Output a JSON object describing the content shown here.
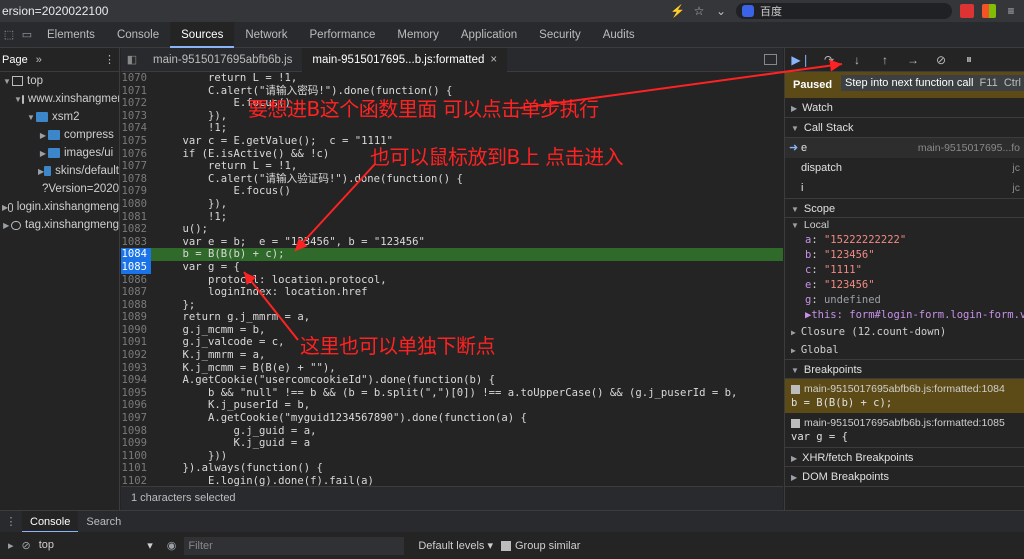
{
  "urlbar": {
    "url": "ersion=2020022100",
    "search": "百度"
  },
  "devtools_tabs": [
    "Elements",
    "Console",
    "Sources",
    "Network",
    "Performance",
    "Memory",
    "Application",
    "Security",
    "Audits"
  ],
  "navigator": {
    "head": "Page",
    "tree": [
      {
        "label": "top",
        "indent": 0,
        "icon": "frame",
        "open": true
      },
      {
        "label": "www.xinshangmeng",
        "indent": 1,
        "icon": "cloud",
        "open": true
      },
      {
        "label": "xsm2",
        "indent": 2,
        "icon": "folder",
        "open": true
      },
      {
        "label": "compress",
        "indent": 3,
        "icon": "folder",
        "open": false
      },
      {
        "label": "images/ui",
        "indent": 3,
        "icon": "folder",
        "open": false
      },
      {
        "label": "skins/default",
        "indent": 3,
        "icon": "folder",
        "open": false
      },
      {
        "label": "?Version=2020",
        "indent": 3,
        "icon": "file",
        "open": null
      },
      {
        "label": "login.xinshangmeng",
        "indent": 0,
        "icon": "cloud",
        "open": false
      },
      {
        "label": "tag.xinshangmeng",
        "indent": 0,
        "icon": "cloud",
        "open": false
      }
    ]
  },
  "editor": {
    "tabs": [
      {
        "label": "main-9515017695abfb6b.js",
        "active": false
      },
      {
        "label": "main-9515017695...b.js:formatted",
        "active": true
      }
    ],
    "status": "1 characters selected",
    "lines": [
      {
        "n": "1070",
        "t": "        return L = !1,"
      },
      {
        "n": "1071",
        "t": "        C.alert(\"请输入密码!\").done(function() {"
      },
      {
        "n": "1072",
        "t": "            E.focus()"
      },
      {
        "n": "1073",
        "t": "        }),"
      },
      {
        "n": "1074",
        "t": "        !1;"
      },
      {
        "n": "1075",
        "t": "    var c = E.getValue();  c = \"1111\""
      },
      {
        "n": "1076",
        "t": "    if (E.isActive() && !c)"
      },
      {
        "n": "1077",
        "t": "        return L = !1,"
      },
      {
        "n": "1078",
        "t": "        C.alert(\"请输入验证码!\").done(function() {"
      },
      {
        "n": "1079",
        "t": "            E.focus()"
      },
      {
        "n": "1080",
        "t": "        }),"
      },
      {
        "n": "1081",
        "t": "        !1;"
      },
      {
        "n": "1082",
        "t": "    u();"
      },
      {
        "n": "1083",
        "t": "    var e = b;  e = \"123456\", b = \"123456\""
      },
      {
        "n": "1084",
        "t": "    b = B(B(b) + c);"
      },
      {
        "n": "1085",
        "t": "    var g = {"
      },
      {
        "n": "1086",
        "t": "        protocol: location.protocol,"
      },
      {
        "n": "1087",
        "t": "        loginIndex: location.href"
      },
      {
        "n": "1088",
        "t": "    };"
      },
      {
        "n": "1089",
        "t": "    return g.j_mmrm = a,"
      },
      {
        "n": "1090",
        "t": "    g.j_mcmm = b,"
      },
      {
        "n": "1091",
        "t": "    g.j_valcode = c,"
      },
      {
        "n": "1092",
        "t": "    K.j_mmrm = a,"
      },
      {
        "n": "1093",
        "t": "    K.j_mcmm = B(B(e) + \"\"),"
      },
      {
        "n": "1094",
        "t": "    A.getCookie(\"usercomcookieId\").done(function(b) {"
      },
      {
        "n": "1095",
        "t": "        b && \"null\" !== b && (b = b.split(\",\")[0]) !== a.toUpperCase() && (g.j_puserId = b,"
      },
      {
        "n": "1096",
        "t": "        K.j_puserId = b,"
      },
      {
        "n": "1097",
        "t": "        A.getCookie(\"myguid1234567890\").done(function(a) {"
      },
      {
        "n": "1098",
        "t": "            g.j_guid = a,"
      },
      {
        "n": "1099",
        "t": "            K.j_guid = a"
      },
      {
        "n": "1100",
        "t": "        }))"
      },
      {
        "n": "1101",
        "t": "    }).always(function() {"
      },
      {
        "n": "1102",
        "t": "        E.login(g).done(f).fail(a)"
      }
    ]
  },
  "debugger": {
    "paused": "Paused",
    "tooltip": "Step into next function call",
    "tooltip_key": "F11",
    "tooltip_extra": "Ctrl",
    "sections": {
      "watch": "Watch",
      "call_stack": "Call Stack",
      "scope": "Scope",
      "local": "Local",
      "closure": "Closure (12.count-down)",
      "global": "Global",
      "breakpoints": "Breakpoints",
      "xhr": "XHR/fetch Breakpoints",
      "dom": "DOM Breakpoints"
    },
    "frames": [
      {
        "name": "e",
        "src": "main-9515017695...fo"
      },
      {
        "name": "dispatch",
        "src": "jc"
      },
      {
        "name": "i",
        "src": "jc"
      }
    ],
    "locals": [
      {
        "k": "a",
        "v": "\"15222222222\""
      },
      {
        "k": "b",
        "v": "\"123456\""
      },
      {
        "k": "c",
        "v": "\"1111\""
      },
      {
        "k": "e",
        "v": "\"123456\""
      },
      {
        "k": "g",
        "v": "undefined"
      }
    ],
    "this_row": "▶this: form#login-form.login-form.val",
    "breakpoints": [
      {
        "file": "main-9515017695abfb6b.js:formatted:1084",
        "code": "b = B(B(b) + c);"
      },
      {
        "file": "main-9515017695abfb6b.js:formatted:1085",
        "code": "var g = {"
      }
    ]
  },
  "drawer": {
    "tabs": [
      "Console",
      "Search"
    ],
    "context": "top",
    "filter_placeholder": "Filter",
    "levels": "Default levels",
    "group_similar": "Group similar"
  },
  "annotations": {
    "a1": "要想进B这个函数里面 可以点击单步执行",
    "a2": "也可以鼠标放到B上 点击进入",
    "a3": "这里也可以单独下断点",
    "color": "#ff2222"
  }
}
